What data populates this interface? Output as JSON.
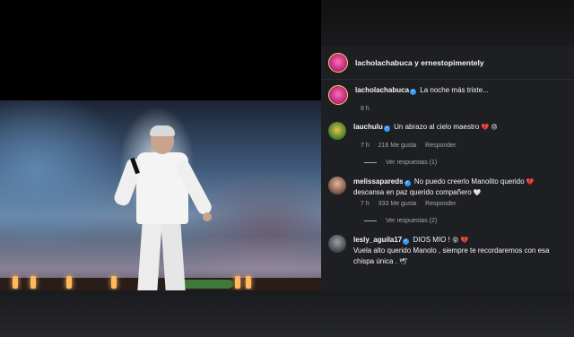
{
  "post": {
    "header_username": "lacholachabuca y ernestopimentely"
  },
  "comments": [
    {
      "username": "lacholachabuca",
      "text": "La noche más triste...",
      "time": "8 h"
    },
    {
      "username": "lauchulu",
      "text": "Un abrazo al cielo maestro",
      "emoji": "💔 😞",
      "time": "7 h",
      "likes": "216 Me gusta",
      "reply_label": "Responder",
      "view_replies": "Ver respuestas (1)"
    },
    {
      "username": "melissapareds",
      "text": "No puedo creerlo Manolito querido",
      "emoji_inline": "💔",
      "text2": "descansa en paz querido compañero",
      "emoji2": "🤍",
      "time": "7 h",
      "likes": "333 Me gusta",
      "reply_label": "Responder",
      "view_replies": "Ver respuestas (2)"
    },
    {
      "username": "lesly_aguila17",
      "text": "DIOS MIO !",
      "emoji": "😵 💔",
      "text2": "Vuela alto querido Manolo , siempre te recordaremos con esa chispa única .",
      "emoji2": "🕊"
    }
  ]
}
